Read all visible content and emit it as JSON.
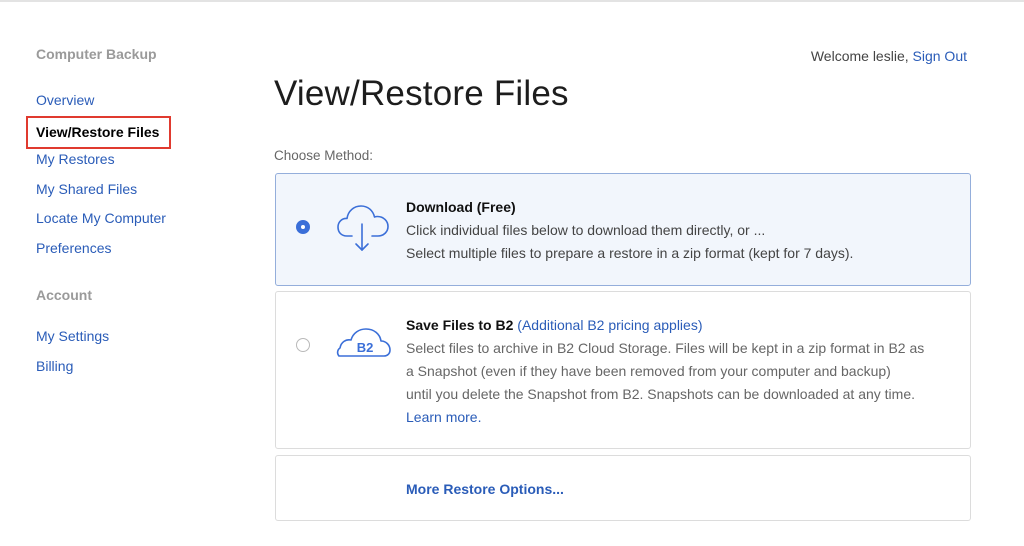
{
  "sidebar": {
    "section1_title": "Computer Backup",
    "section1_items": [
      "Overview",
      "View/Restore Files",
      "My Restores",
      "My Shared Files",
      "Locate My Computer",
      "Preferences"
    ],
    "active_item": "View/Restore Files",
    "section2_title": "Account",
    "section2_items": [
      "My Settings",
      "Billing"
    ]
  },
  "header": {
    "welcome_text": "Welcome leslie,",
    "sign_out": "Sign Out"
  },
  "main": {
    "title": "View/Restore Files",
    "choose_label": "Choose Method:",
    "options": [
      {
        "title": "Download (Free)",
        "line1": "Click individual files below to download them directly, or ...",
        "line2": "Select multiple files to prepare a restore in a zip format (kept for 7 days).",
        "selected": true,
        "icon": "cloud-download-icon"
      },
      {
        "title": "Save Files to B2",
        "note": "(Additional B2 pricing applies)",
        "line1": "Select files to archive in B2 Cloud Storage. Files will be kept in a zip format in B2 as",
        "line2": "a Snapshot (even if they have been removed from your computer and backup)",
        "line3": "until you delete the Snapshot from B2. Snapshots can be downloaded at any time.",
        "learn_more": "Learn more.",
        "selected": false,
        "icon": "b2-cloud-icon",
        "icon_text": "B2"
      }
    ],
    "more_options": "More Restore Options..."
  },
  "colors": {
    "link": "#2a5cb8",
    "highlight_box": "#e03a2f",
    "selected_card_bg": "#f2f6fc",
    "radio_selected": "#3b6fd8"
  }
}
